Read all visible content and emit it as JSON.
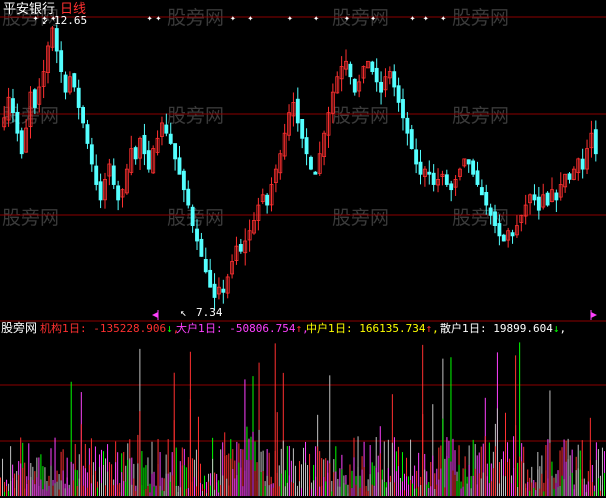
{
  "header": {
    "stock_name": "平安银行",
    "period": "日线"
  },
  "watermark_text": "股旁网",
  "indicator": {
    "label_prefix": "股旁网",
    "items": [
      {
        "name": "机构1日",
        "value": "-135228.906",
        "arrow": "↓",
        "color": "#ff3030"
      },
      {
        "name": "大户1日",
        "value": "-50806.754",
        "arrow": "↑",
        "color": "#ff40ff"
      },
      {
        "name": "中户1日",
        "value": "166135.734",
        "arrow": "↑",
        "color": "#ffff00"
      },
      {
        "name": "散户1日",
        "value": "19899.604",
        "arrow": "↓",
        "color": "#ffffff"
      }
    ]
  },
  "colors": {
    "background": "#000000",
    "up": "#ff3030",
    "down": "#54ffff",
    "grid": "#8b0000",
    "signal_star": "#ffffff",
    "purple": "#ff40ff",
    "green": "#00ff00",
    "gray": "#c0c0c0"
  },
  "chart_data": [
    {
      "type": "candlestick",
      "title": "平安银行 日线",
      "annotations": [
        {
          "label": "12.65",
          "kind": "high"
        },
        {
          "label": "7.34",
          "kind": "low"
        }
      ],
      "ylim": [
        7.0,
        13.0
      ],
      "close": [
        10.9,
        11.3,
        11.0,
        10.6,
        10.2,
        10.7,
        11.4,
        11.1,
        11.5,
        11.8,
        12.3,
        12.65,
        12.2,
        11.8,
        11.4,
        11.7,
        11.5,
        11.1,
        10.8,
        10.4,
        10.0,
        9.6,
        9.3,
        9.7,
        10.0,
        9.6,
        9.3,
        9.5,
        9.9,
        10.3,
        10.1,
        10.5,
        10.2,
        9.9,
        10.3,
        10.5,
        10.8,
        10.6,
        10.4,
        10.1,
        9.8,
        9.5,
        9.2,
        8.8,
        8.5,
        8.2,
        7.9,
        7.6,
        7.4,
        7.6,
        7.5,
        7.8,
        8.1,
        8.4,
        8.3,
        8.5,
        8.7,
        8.9,
        9.2,
        9.4,
        9.2,
        9.6,
        9.9,
        10.2,
        10.6,
        11.0,
        11.2,
        10.8,
        10.5,
        10.2,
        9.9,
        9.8,
        10.2,
        10.6,
        11.0,
        11.4,
        11.7,
        11.9,
        12.0,
        11.7,
        11.4,
        11.6,
        11.9,
        12.0,
        11.8,
        11.6,
        11.4,
        11.7,
        11.8,
        11.5,
        11.2,
        10.9,
        10.6,
        10.3,
        10.0,
        9.8,
        9.9,
        9.8,
        9.6,
        9.7,
        9.8,
        9.6,
        9.5,
        9.7,
        9.9,
        10.1,
        10.0,
        9.8,
        9.6,
        9.4,
        9.2,
        9.0,
        8.8,
        8.6,
        8.5,
        8.7,
        8.6,
        8.8,
        9.0,
        9.2,
        9.4,
        9.3,
        9.1,
        9.4,
        9.2,
        9.5,
        9.3,
        9.6,
        9.8,
        9.7,
        9.9,
        10.1,
        9.9,
        10.3,
        10.6,
        10.2
      ]
    },
    {
      "type": "bar",
      "title": "股旁网",
      "series": [
        {
          "name": "机构1日",
          "color": "#ff3030"
        },
        {
          "name": "大户1日",
          "color": "#ff40ff"
        },
        {
          "name": "中户1日",
          "color": "#ffff00"
        },
        {
          "name": "散户1日",
          "color": "#ffffff"
        }
      ]
    }
  ]
}
